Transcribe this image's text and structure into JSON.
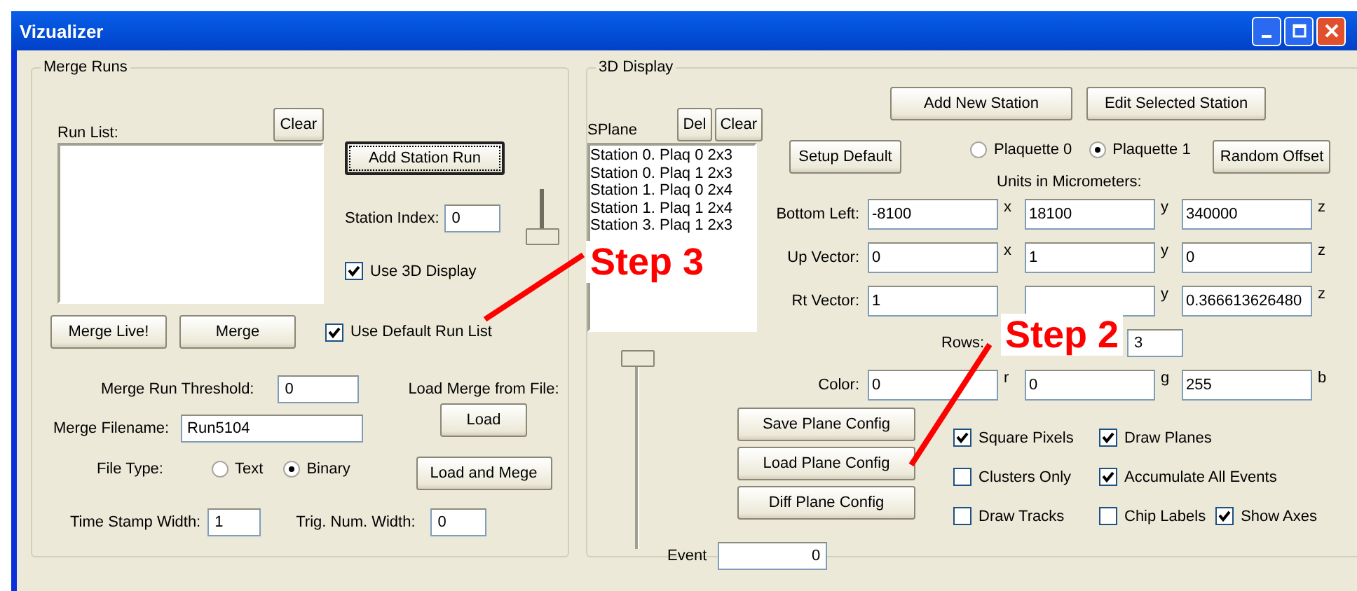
{
  "window": {
    "title": "Vizualizer"
  },
  "merge_runs": {
    "title": "Merge Runs",
    "run_list_label": "Run List:",
    "clear_button": "Clear",
    "add_station_run_button": "Add Station Run",
    "station_index": {
      "label": "Station Index:",
      "value": "0",
      "slider": {
        "level": 1
      }
    },
    "use_3d_display": {
      "label": "Use 3D Display",
      "checked": true
    },
    "merge_live_button": "Merge Live!",
    "merge_button": "Merge",
    "use_default_run_list": {
      "label": "Use Default Run List",
      "checked": true
    },
    "merge_run_threshold": {
      "label": "Merge Run Threshold:",
      "value": "0"
    },
    "load_merge_label": "Load Merge from File:",
    "load_button": "Load",
    "merge_filename": {
      "label": "Merge Filename:",
      "value": "Run5104"
    },
    "file_type": {
      "label": "File Type:",
      "options": [
        {
          "label": "Text",
          "selected": false
        },
        {
          "label": "Binary",
          "selected": true
        }
      ]
    },
    "load_and_merge_button": "Load and Mege",
    "time_stamp_width": {
      "label": "Time Stamp Width:",
      "value": "1"
    },
    "trig_num_width": {
      "label": "Trig. Num. Width:",
      "value": "0"
    }
  },
  "display_3d": {
    "title": "3D Display",
    "splane_label": "SPlane",
    "del_button": "Del",
    "clear_button": "Clear",
    "stations": [
      {
        "label": "Station 0. Plaq 0 2x3"
      },
      {
        "label": "Station 0. Plaq 1 2x3"
      },
      {
        "label": "Station 1. Plaq 0 2x4"
      },
      {
        "label": "Station 1. Plaq 1 2x4"
      },
      {
        "label": "Station 3. Plaq 1 2x3"
      }
    ],
    "event_slider": {
      "level": 0
    },
    "event": {
      "label": "Event",
      "value": "0"
    },
    "add_new_station_button": "Add New Station",
    "edit_selected_station_button": "Edit Selected Station",
    "setup_default_button": "Setup Default",
    "plaquette": [
      {
        "label": "Plaquette 0",
        "selected": false
      },
      {
        "label": "Plaquette 1",
        "selected": true
      }
    ],
    "random_offset_button": "Random Offset",
    "units_label": "Units in Micrometers:",
    "coordinate_rows": [
      {
        "kind": "vector",
        "label": "Bottom Left:",
        "fields": [
          {
            "value": "-8100",
            "axis": "x"
          },
          {
            "value": "18100",
            "axis": "y"
          },
          {
            "value": "340000",
            "axis": "z"
          }
        ]
      },
      {
        "kind": "vector",
        "label": "Up Vector:",
        "fields": [
          {
            "value": "0",
            "axis": "x"
          },
          {
            "value": "1",
            "axis": "y"
          },
          {
            "value": "0",
            "axis": "z"
          }
        ]
      },
      {
        "kind": "vector",
        "label": "Rt Vector:",
        "fields": [
          {
            "value": "1"
          },
          {
            "axis": "y"
          },
          {
            "value": "0.366613626480",
            "axis": "z"
          }
        ]
      },
      {
        "kind": "rows",
        "label": "Rows:",
        "value": "3"
      },
      {
        "kind": "vector",
        "label": "Color:",
        "fields": [
          {
            "value": "0",
            "axis": "r"
          },
          {
            "value": "0",
            "axis": "g"
          },
          {
            "value": "255",
            "axis": "b"
          }
        ]
      }
    ],
    "config_buttons": [
      "Save Plane Config",
      "Load Plane Config",
      "Diff Plane Config"
    ],
    "option_rows": [
      [
        {
          "label": "Square Pixels",
          "checked": true
        },
        {
          "label": "Draw Planes",
          "checked": true
        }
      ],
      [
        {
          "label": "Clusters Only",
          "checked": false
        },
        {
          "label": "Accumulate All Events",
          "checked": true
        }
      ],
      [
        {
          "label": "Draw Tracks",
          "checked": false
        },
        {
          "label": "Chip Labels",
          "checked": false
        },
        {
          "label": "Show Axes",
          "checked": true
        }
      ]
    ]
  },
  "annotations": [
    {
      "text": "Step 3"
    },
    {
      "text": "Step 2"
    }
  ]
}
